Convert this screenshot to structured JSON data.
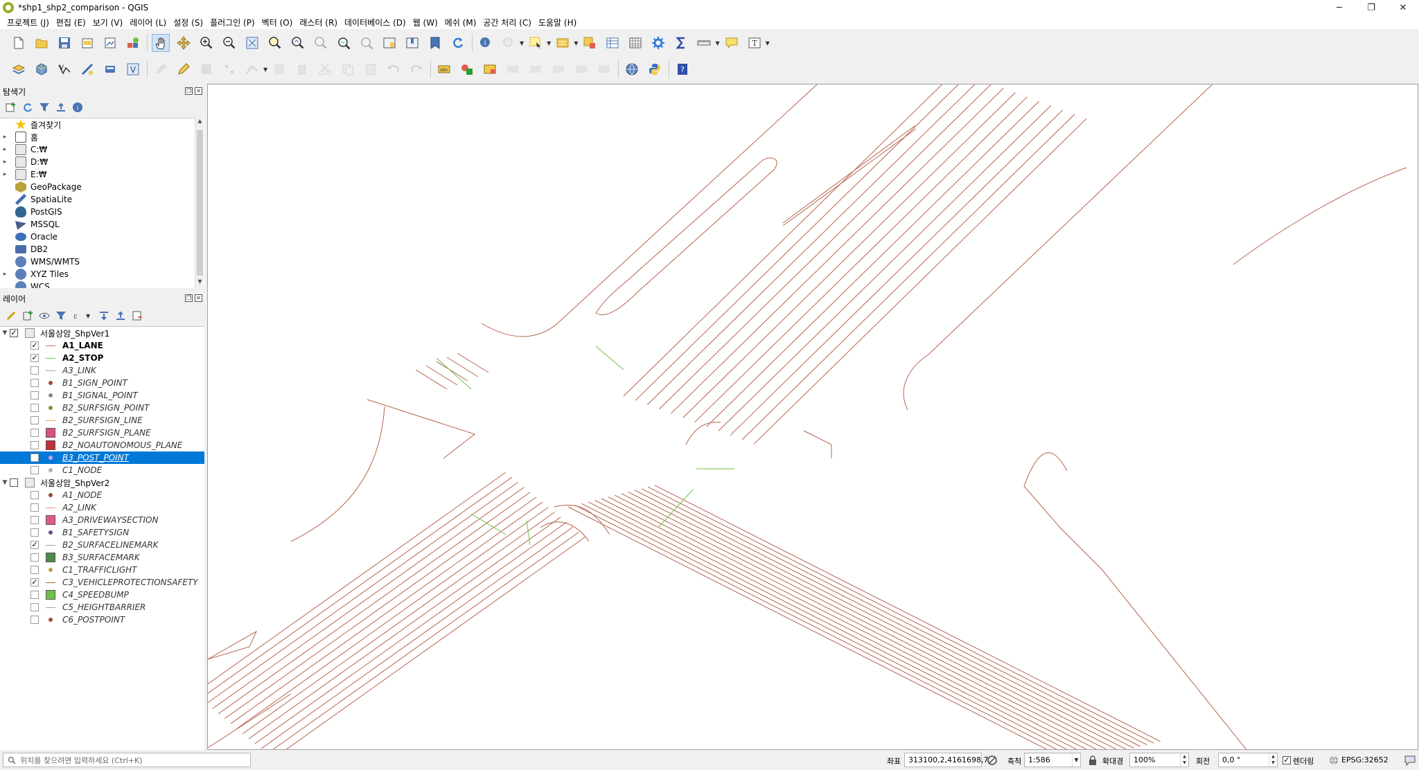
{
  "window": {
    "title": "*shp1_shp2_comparison - QGIS",
    "min": "─",
    "restore": "❐",
    "close": "✕"
  },
  "menu": [
    "프로젝트 (J)",
    "편집 (E)",
    "보기 (V)",
    "레이어 (L)",
    "설정 (S)",
    "플러그인 (P)",
    "벡터 (O)",
    "래스터 (R)",
    "데이터베이스 (D)",
    "웹 (W)",
    "메쉬 (M)",
    "공간 처리 (C)",
    "도움말 (H)"
  ],
  "browser": {
    "title": "탐색기",
    "items": [
      {
        "label": "즐겨찾기",
        "icon": "star-icon",
        "color": "#f2c200",
        "expand": ""
      },
      {
        "label": "홈",
        "icon": "home-folder-icon",
        "color": "#7a7a7a",
        "expand": "▸"
      },
      {
        "label": "C:₩",
        "icon": "drive-icon",
        "color": "#9aa0a6",
        "expand": "▸"
      },
      {
        "label": "D:₩",
        "icon": "drive-icon",
        "color": "#9aa0a6",
        "expand": "▸"
      },
      {
        "label": "E:₩",
        "icon": "drive-icon",
        "color": "#9aa0a6",
        "expand": "▸"
      },
      {
        "label": "GeoPackage",
        "icon": "geopackage-icon",
        "color": "#b9a23a",
        "expand": ""
      },
      {
        "label": "SpatiaLite",
        "icon": "spatialite-icon",
        "color": "#3d6fb6",
        "expand": ""
      },
      {
        "label": "PostGIS",
        "icon": "postgis-icon",
        "color": "#336791",
        "expand": ""
      },
      {
        "label": "MSSQL",
        "icon": "mssql-icon",
        "color": "#4a5d8a",
        "expand": ""
      },
      {
        "label": "Oracle",
        "icon": "oracle-icon",
        "color": "#3d6fb6",
        "expand": ""
      },
      {
        "label": "DB2",
        "icon": "db2-icon",
        "color": "#4b6ca8",
        "expand": ""
      },
      {
        "label": "WMS/WMTS",
        "icon": "globe-icon",
        "color": "#5b7fb8",
        "expand": ""
      },
      {
        "label": "XYZ Tiles",
        "icon": "xyz-tiles-icon",
        "color": "#5b7fb8",
        "expand": "▸"
      },
      {
        "label": "WCS",
        "icon": "globe-icon",
        "color": "#5b7fb8",
        "expand": ""
      }
    ]
  },
  "layers": {
    "title": "레이어",
    "groups": [
      {
        "name": "서울상암_ShpVer1",
        "checked": "✓",
        "items": [
          {
            "name": "A1_LANE",
            "checked": "✓",
            "sym": "line",
            "color": "#c0715c",
            "style": "bold",
            "sel": ""
          },
          {
            "name": "A2_STOP",
            "checked": "✓",
            "sym": "line",
            "color": "#6fbf4a",
            "style": "bold",
            "sel": ""
          },
          {
            "name": "A3_LINK",
            "checked": "",
            "sym": "line",
            "color": "#a0a0a0",
            "style": "italic",
            "sel": ""
          },
          {
            "name": "B1_SIGN_POINT",
            "checked": "",
            "sym": "dot",
            "color": "#9b4a3c",
            "style": "italic",
            "sel": ""
          },
          {
            "name": "B1_SIGNAL_POINT",
            "checked": "",
            "sym": "dot",
            "color": "#8a8a8a",
            "style": "italic",
            "sel": ""
          },
          {
            "name": "B2_SURFSIGN_POINT",
            "checked": "",
            "sym": "dot",
            "color": "#6f9a3a",
            "style": "italic",
            "sel": ""
          },
          {
            "name": "B2_SURFSIGN_LINE",
            "checked": "",
            "sym": "line",
            "color": "#e0b04a",
            "style": "italic",
            "sel": ""
          },
          {
            "name": "B2_SURFSIGN_PLANE",
            "checked": "",
            "sym": "fill",
            "color": "#d9547a",
            "style": "italic",
            "sel": ""
          },
          {
            "name": "B2_NOAUTONOMOUS_PLANE",
            "checked": "",
            "sym": "fill",
            "color": "#c0303a",
            "style": "italic",
            "sel": ""
          },
          {
            "name": "B3_POST_POINT",
            "checked": "",
            "sym": "dot",
            "color": "#d8a0e0",
            "style": "italic",
            "sel": "selected"
          },
          {
            "name": "C1_NODE",
            "checked": "",
            "sym": "dot",
            "color": "#b0b0b0",
            "style": "italic",
            "sel": ""
          }
        ]
      },
      {
        "name": "서울상암_ShpVer2",
        "checked": "",
        "items": [
          {
            "name": "A1_NODE",
            "checked": "",
            "sym": "dot",
            "color": "#9b4a3c",
            "style": "italic",
            "sel": ""
          },
          {
            "name": "A2_LINK",
            "checked": "",
            "sym": "line",
            "color": "#e09a80",
            "style": "italic",
            "sel": ""
          },
          {
            "name": "A3_DRIVEWAYSECTION",
            "checked": "",
            "sym": "fill",
            "color": "#e0588a",
            "style": "italic",
            "sel": ""
          },
          {
            "name": "B1_SAFETYSIGN",
            "checked": "",
            "sym": "dot",
            "color": "#6a4a8a",
            "style": "italic",
            "sel": ""
          },
          {
            "name": "B2_SURFACELINEMARK",
            "checked": "✓",
            "sym": "line",
            "color": "#a0a0a0",
            "style": "italic",
            "sel": ""
          },
          {
            "name": "B3_SURFACEMARK",
            "checked": "",
            "sym": "fill",
            "color": "#4a8a4a",
            "style": "italic",
            "sel": ""
          },
          {
            "name": "C1_TRAFFICLIGHT",
            "checked": "",
            "sym": "dot",
            "color": "#c0a040",
            "style": "italic",
            "sel": ""
          },
          {
            "name": "C3_VEHICLEPROTECTIONSAFETY",
            "checked": "✓",
            "sym": "line",
            "color": "#9a6a3a",
            "style": "italic",
            "sel": ""
          },
          {
            "name": "C4_SPEEDBUMP",
            "checked": "",
            "sym": "fill",
            "color": "#6fbf4a",
            "style": "italic",
            "sel": ""
          },
          {
            "name": "C5_HEIGHTBARRIER",
            "checked": "",
            "sym": "line",
            "color": "#a0a0a0",
            "style": "italic",
            "sel": ""
          },
          {
            "name": "C6_POSTPOINT",
            "checked": "",
            "sym": "dot",
            "color": "#9b4a3c",
            "style": "italic",
            "sel": ""
          }
        ]
      }
    ]
  },
  "status": {
    "locator_placeholder": "위치를 찾으려면 입력하세요 (Ctrl+K)",
    "coord_label": "좌표",
    "coord_value": "313100,2,4161698,7",
    "scale_label": "축척",
    "scale_value": "1:586",
    "magnifier_label": "확대경",
    "magnifier_value": "100%",
    "rotation_label": "회전",
    "rotation_value": "0,0 °",
    "render_label": "렌더링",
    "render_checked": "✓",
    "crs": "EPSG:32652"
  },
  "map": {
    "lane_color": "#b5634d",
    "stop_color": "#6fbf4a"
  }
}
